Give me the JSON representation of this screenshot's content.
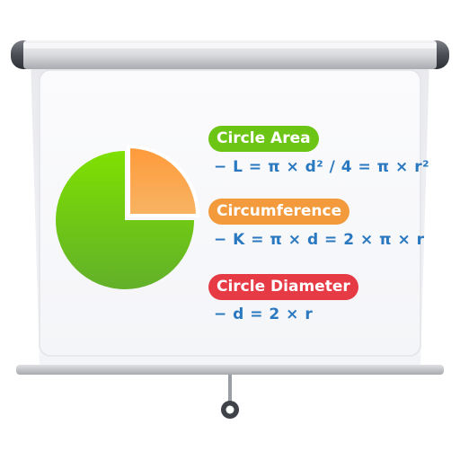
{
  "colors": {
    "area_badge": "#6cc414",
    "circumference_badge": "#f29a3c",
    "diameter_badge": "#e63a45",
    "formula_text": "#2a78c0",
    "pie_main": "#7ed321",
    "pie_slice": "#f5a04a"
  },
  "icons": {
    "pie": "pie-chart-icon",
    "screen": "projector-screen-icon"
  },
  "items": [
    {
      "label": "Circle Area",
      "formula": "− L = π × d² / 4 = π × r²"
    },
    {
      "label": "Circumference",
      "formula": "− K = π × d = 2 × π × r"
    },
    {
      "label": "Circle Diameter",
      "formula": "− d = 2 × r"
    }
  ]
}
